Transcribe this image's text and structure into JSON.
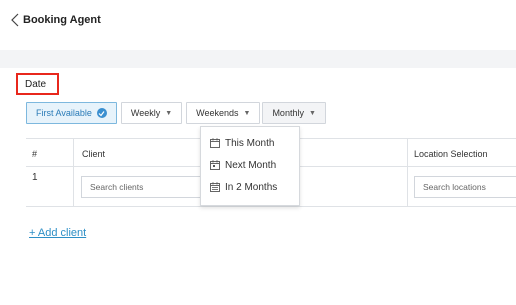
{
  "header": {
    "back_icon": "chevron-left-icon",
    "title": "Booking Agent"
  },
  "section": {
    "date_label": "Date"
  },
  "tabs": [
    {
      "label": "First Available",
      "active": true,
      "icon": "check-circle-icon"
    },
    {
      "label": "Weekly",
      "icon": "caret-down-icon"
    },
    {
      "label": "Weekends",
      "icon": "caret-down-icon"
    },
    {
      "label": "Monthly",
      "icon": "caret-down-icon"
    }
  ],
  "table": {
    "columns": [
      "#",
      "Client",
      "Location Selection"
    ],
    "rows": [
      {
        "number": "1",
        "client_placeholder": "Search clients",
        "location_placeholder": "Search locations"
      }
    ]
  },
  "add_client_label": "+ Add client",
  "monthly_dropdown": {
    "items": [
      {
        "label": "This Month",
        "icon": "calendar-icon"
      },
      {
        "label": "Next Month",
        "icon": "calendar-icon"
      },
      {
        "label": "In 2 Months",
        "icon": "calendar-icon"
      }
    ]
  },
  "colors": {
    "accent": "#2d8fc6",
    "highlight_border": "#e8271c",
    "active_tab_bg": "#e7f3fb"
  }
}
